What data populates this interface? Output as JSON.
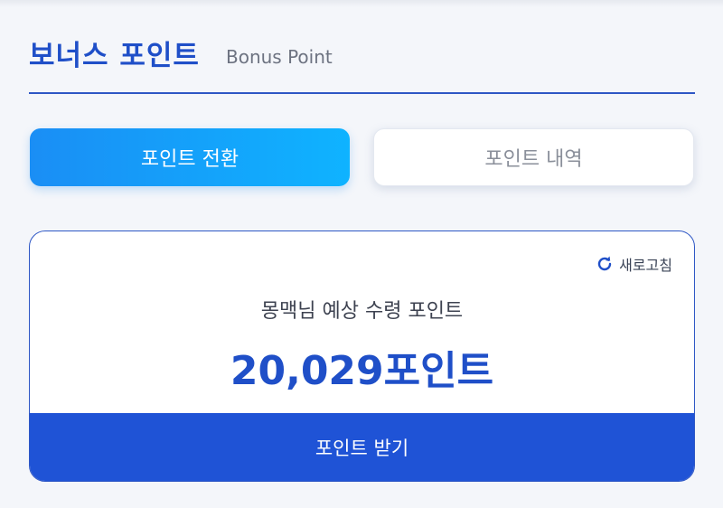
{
  "header": {
    "title": "보너스 포인트",
    "subtitle": "Bonus Point"
  },
  "tabs": [
    {
      "label": "포인트 전환",
      "active": true
    },
    {
      "label": "포인트 내역",
      "active": false
    }
  ],
  "card": {
    "refresh_label": "새로고침",
    "refresh_icon": "refresh-icon",
    "expected_label": "몽맥님 예상 수령 포인트",
    "points_value": "20,029포인트",
    "receive_button_label": "포인트 받기"
  },
  "colors": {
    "primary": "#1f4fc8",
    "button": "#1f53d6",
    "tab_gradient_start": "#1a8ef5",
    "tab_gradient_end": "#0fb3ff"
  }
}
